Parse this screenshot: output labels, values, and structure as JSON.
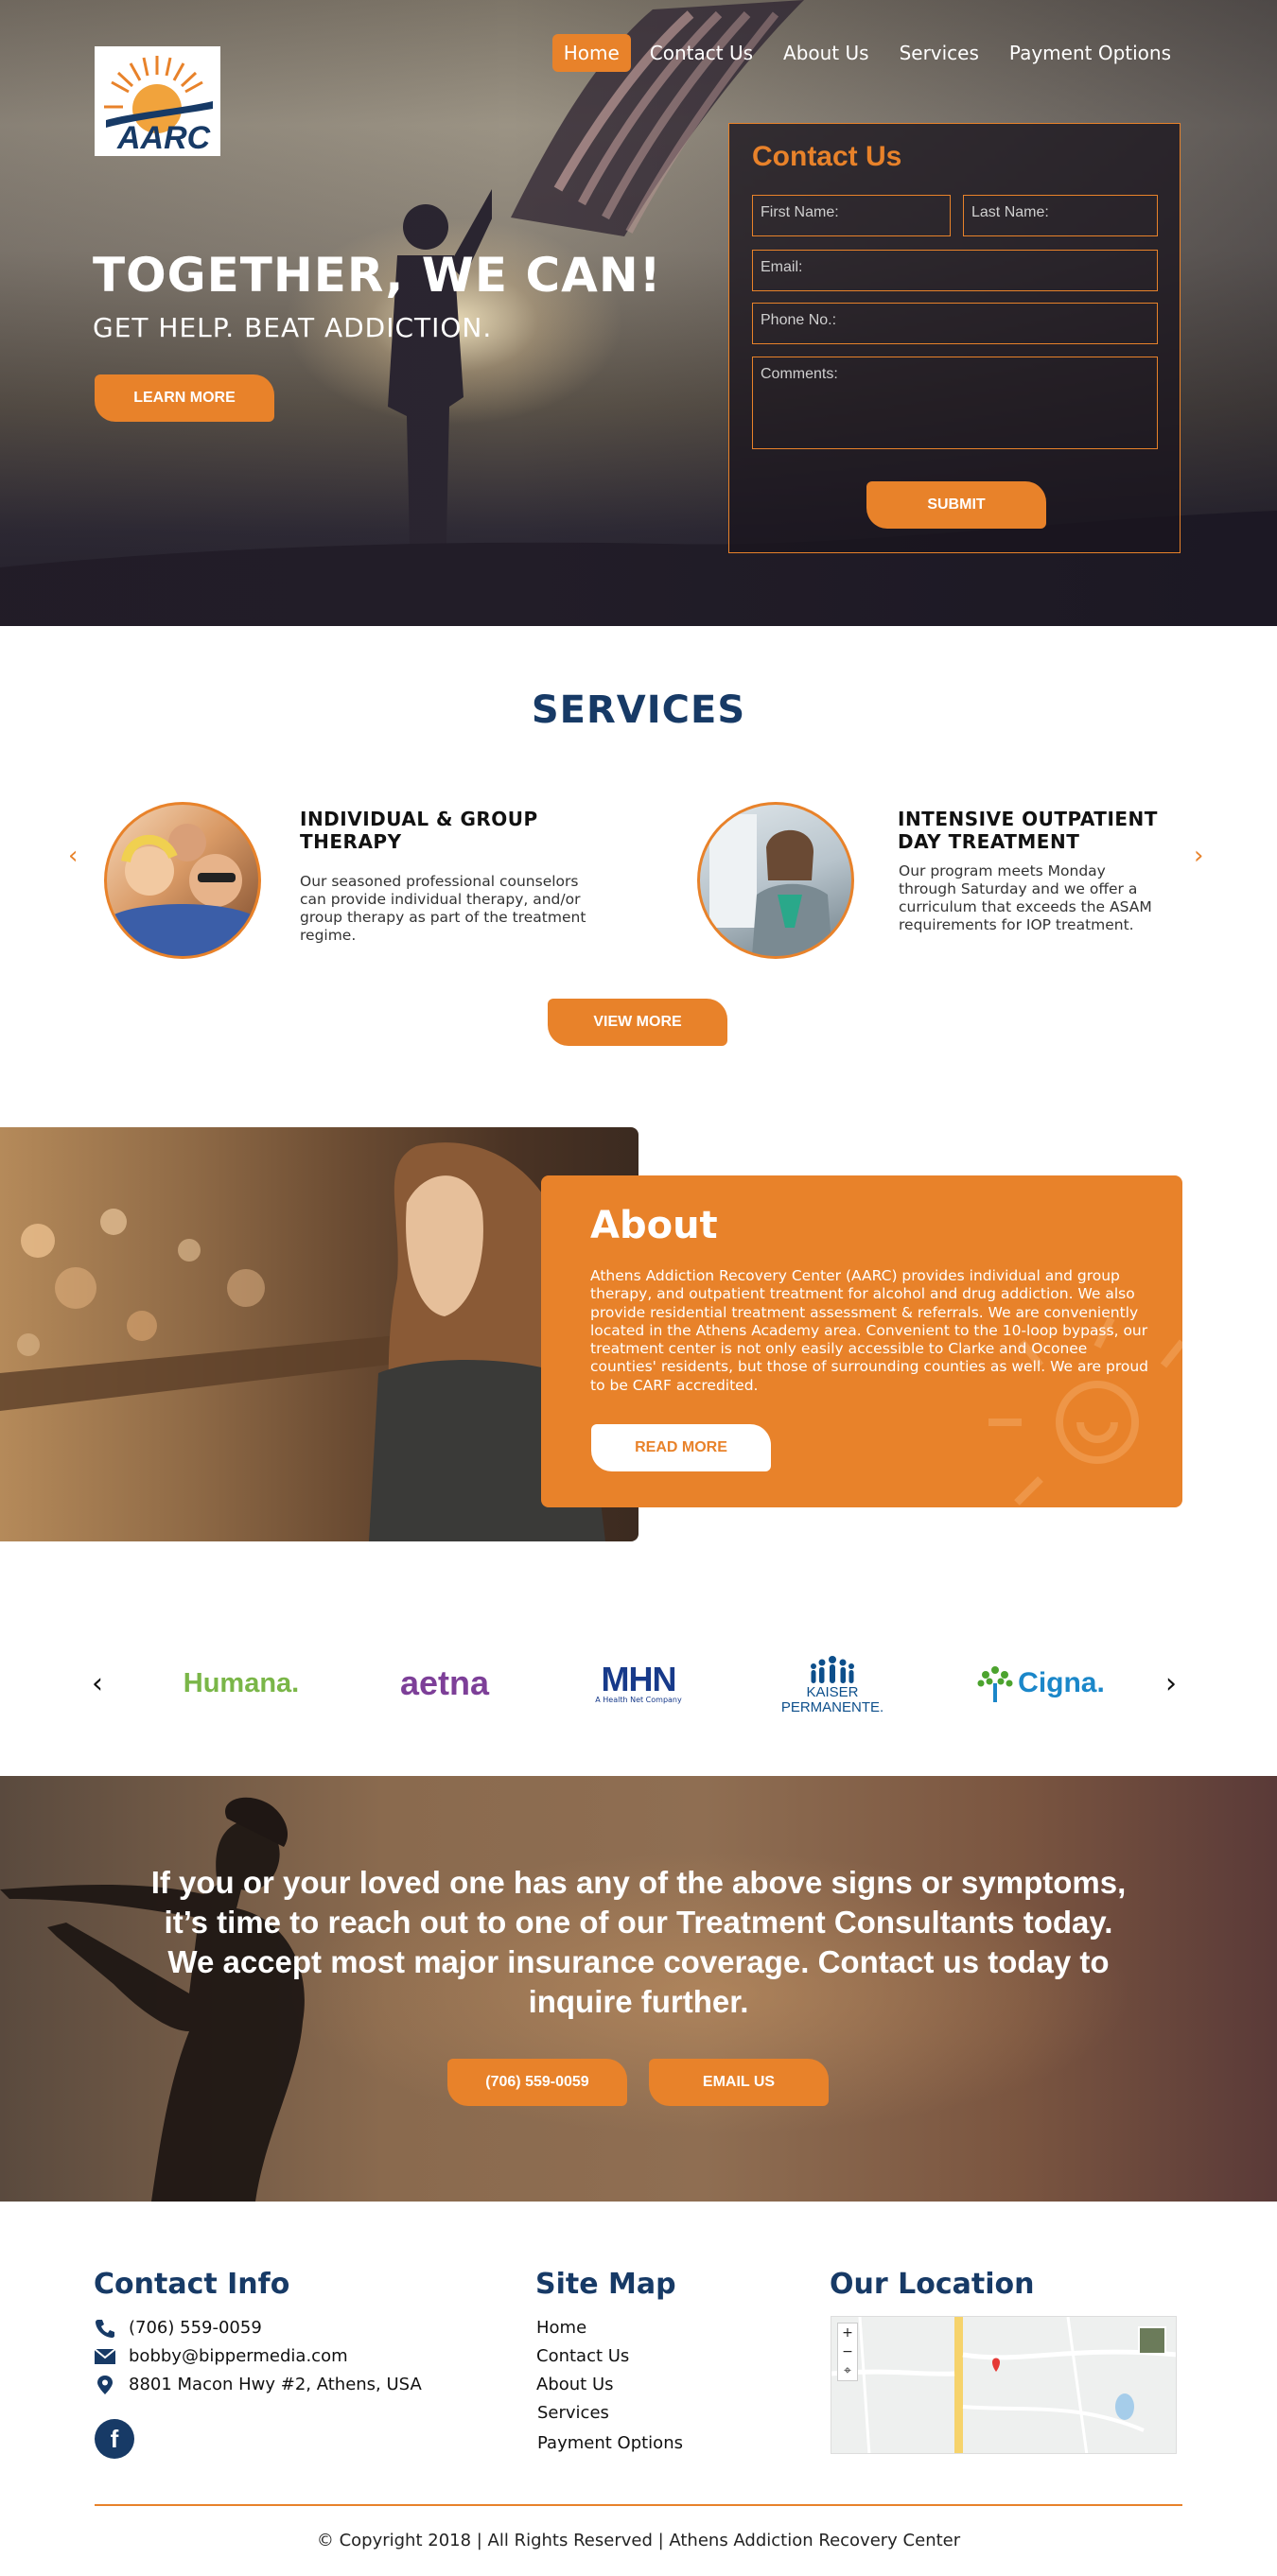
{
  "brand": {
    "logo_text": "AARC",
    "accent": "#e8822a",
    "navy": "#173a66"
  },
  "nav": {
    "items": [
      {
        "label": "Home",
        "active": true
      },
      {
        "label": "Contact Us"
      },
      {
        "label": "About Us"
      },
      {
        "label": "Services"
      },
      {
        "label": "Payment Options"
      }
    ]
  },
  "hero": {
    "title": "TOGETHER, WE CAN!",
    "subtitle": "GET HELP. BEAT ADDICTION.",
    "button": "LEARN MORE"
  },
  "contact_form": {
    "title": "Contact Us",
    "first_name": "First Name:",
    "last_name": "Last Name:",
    "email": "Email:",
    "phone": "Phone No.:",
    "comments": "Comments:",
    "submit": "SUBMIT"
  },
  "services": {
    "title": "SERVICES",
    "items": [
      {
        "title": "INDIVIDUAL & GROUP THERAPY",
        "text": "Our seasoned professional counselors can provide individual therapy, and/or group therapy as part of the treatment regime."
      },
      {
        "title": "INTENSIVE OUTPATIENT DAY TREATMENT",
        "text": "Our program meets Monday through Saturday and we offer a curriculum that exceeds the ASAM requirements for IOP treatment."
      }
    ],
    "button": "VIEW MORE"
  },
  "about": {
    "title": "About",
    "text": "Athens Addiction Recovery Center (AARC) provides individual and group therapy, and outpatient treatment for alcohol and drug addiction. We also provide residential treatment assessment & referrals. We are conveniently located in the Athens Academy area. Convenient to the 10-loop bypass, our treatment center is not only easily accessible to Clarke and Oconee counties' residents, but those of surrounding counties as well.  We are proud to be CARF accredited.",
    "button": "READ MORE"
  },
  "insurers": {
    "humana": "Humana.",
    "aetna": "aetna",
    "mhn": "MHN",
    "mhn_tag": "A Health Net Company",
    "kaiser_1": "KAISER",
    "kaiser_2": "PERMANENTE.",
    "cigna": "Cigna."
  },
  "cta": {
    "text": "If you or your loved one has any of the above signs or symptoms, it’s time to reach out to one of our Treatment Consultants today.  We accept most major insurance coverage. Contact us today to inquire further.",
    "phone_button": "(706) 559-0059",
    "email_button": "EMAIL US"
  },
  "footer": {
    "contact_title": "Contact Info",
    "phone": "(706) 559-0059",
    "email": "bobby@bippermedia.com",
    "address": "8801 Macon Hwy #2, Athens, USA",
    "facebook": "f",
    "sitemap_title": "Site Map",
    "sitemap": [
      "Home",
      "Contact Us",
      "About Us",
      "Services",
      "Payment Options"
    ],
    "location_title": "Our Location",
    "copyright": "© Copyright 2018 | All Rights Reserved | Athens Addiction Recovery Center"
  }
}
